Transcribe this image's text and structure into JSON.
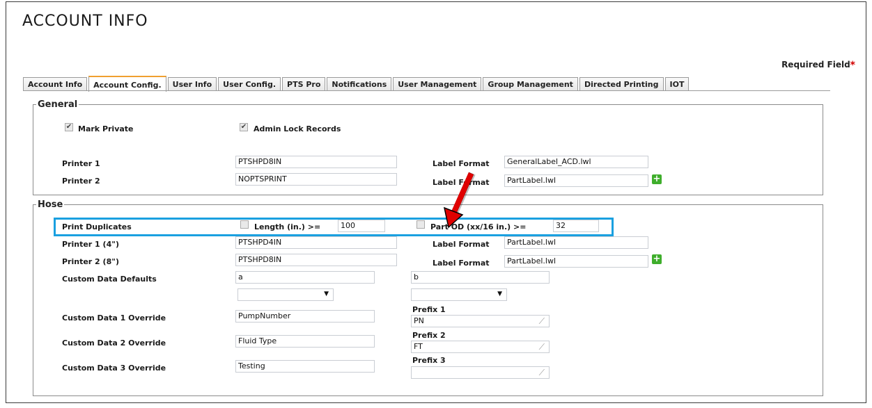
{
  "page": {
    "title": "ACCOUNT INFO",
    "required_label": "Required Field",
    "required_star": "*"
  },
  "tabs": [
    "Account Info",
    "Account Config.",
    "User Info",
    "User Config.",
    "PTS Pro",
    "Notifications",
    "User Management",
    "Group Management",
    "Directed Printing",
    "IOT"
  ],
  "active_tab": "Account Config.",
  "general": {
    "legend": "General",
    "mark_private": "Mark Private",
    "admin_lock": "Admin Lock Records",
    "printer1_label": "Printer 1",
    "printer1_value": "PTSHPD8IN",
    "printer2_label": "Printer 2",
    "printer2_value": "NOPTSPRINT",
    "label_format_label": "Label Format",
    "label_format1_value": "GeneralLabel_ACD.lwl",
    "label_format2_value": "PartLabel.lwl"
  },
  "hose": {
    "legend": "Hose",
    "print_duplicates": "Print Duplicates",
    "length_label": "Length (in.) >=",
    "length_value": "100",
    "part_od_label": "Part OD (xx/16 in.) >=",
    "part_od_value": "32",
    "printer1_label": "Printer 1 (4\")",
    "printer1_value": "PTSHPD4IN",
    "printer2_label": "Printer 2 (8\")",
    "printer2_value": "PTSHPD8IN",
    "label_format_label": "Label Format",
    "label_format1_value": "PartLabel.lwl",
    "label_format2_value": "PartLabel.lwl",
    "custom_defaults_label": "Custom Data Defaults",
    "custom_default_a": "a",
    "custom_default_b": "b",
    "override1_label": "Custom Data 1 Override",
    "override1_value": "PumpNumber",
    "override2_label": "Custom Data 2 Override",
    "override2_value": "Fluid Type",
    "override3_label": "Custom Data 3 Override",
    "override3_value": "Testing",
    "prefix1_label": "Prefix 1",
    "prefix1_value": "PN",
    "prefix2_label": "Prefix 2",
    "prefix2_value": "FT",
    "prefix3_label": "Prefix 3",
    "prefix3_value": ""
  },
  "colors": {
    "highlight": "#1aa0e0",
    "arrow": "#e00000",
    "plus": "#3fae2c",
    "active_tab_top": "#f0a030"
  },
  "icons": {
    "checkbox": "check-icon",
    "plus": "add-icon",
    "wrench": "wrench-icon",
    "dropdown": "chevron-down-icon"
  }
}
